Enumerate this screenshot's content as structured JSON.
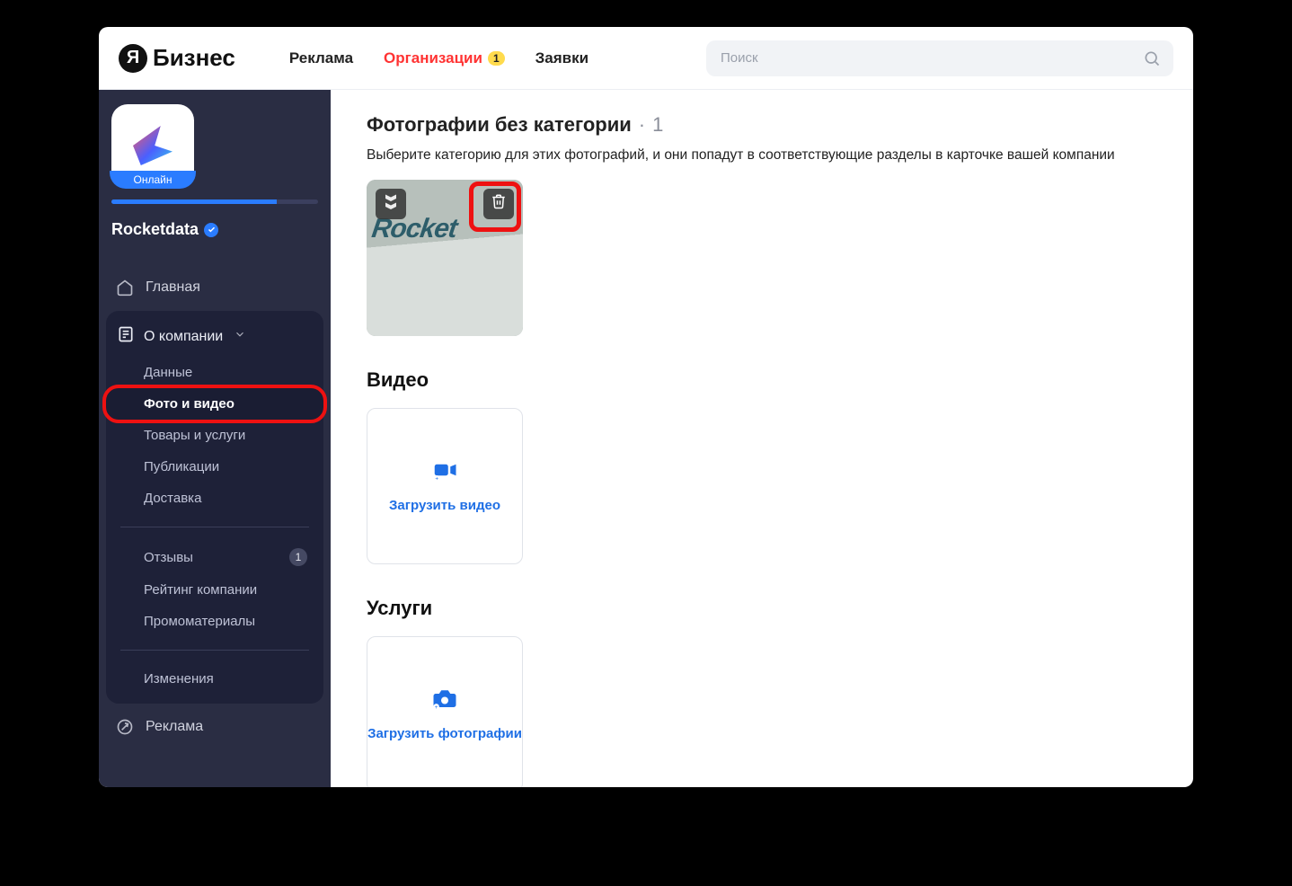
{
  "header": {
    "logo_text": "Бизнес",
    "logo_letter": "Я",
    "nav": {
      "ads": "Реклама",
      "orgs": "Организации",
      "orgs_badge": "1",
      "requests": "Заявки"
    },
    "search_placeholder": "Поиск"
  },
  "sidebar": {
    "org_status": "Онлайн",
    "org_name": "Rocketdata",
    "items": {
      "home": "Главная",
      "about_company": "О компании",
      "data": "Данные",
      "photo_video": "Фото и видео",
      "goods_services": "Товары и услуги",
      "publications": "Публикации",
      "delivery": "Доставка",
      "reviews": "Отзывы",
      "reviews_badge": "1",
      "company_rating": "Рейтинг компании",
      "promo": "Промоматериалы",
      "changes": "Изменения",
      "advertising": "Реклама"
    }
  },
  "main": {
    "uncat_title": "Фотографии без категории",
    "uncat_count": "1",
    "uncat_desc": "Выберите категорию для этих фотографий, и они попадут в соответствующие разделы в карточке вашей компании",
    "photo_sign": "Rocket",
    "video_heading": "Видео",
    "video_upload": "Загрузить видео",
    "services_heading": "Услуги",
    "services_upload": "Загрузить фотографии"
  }
}
